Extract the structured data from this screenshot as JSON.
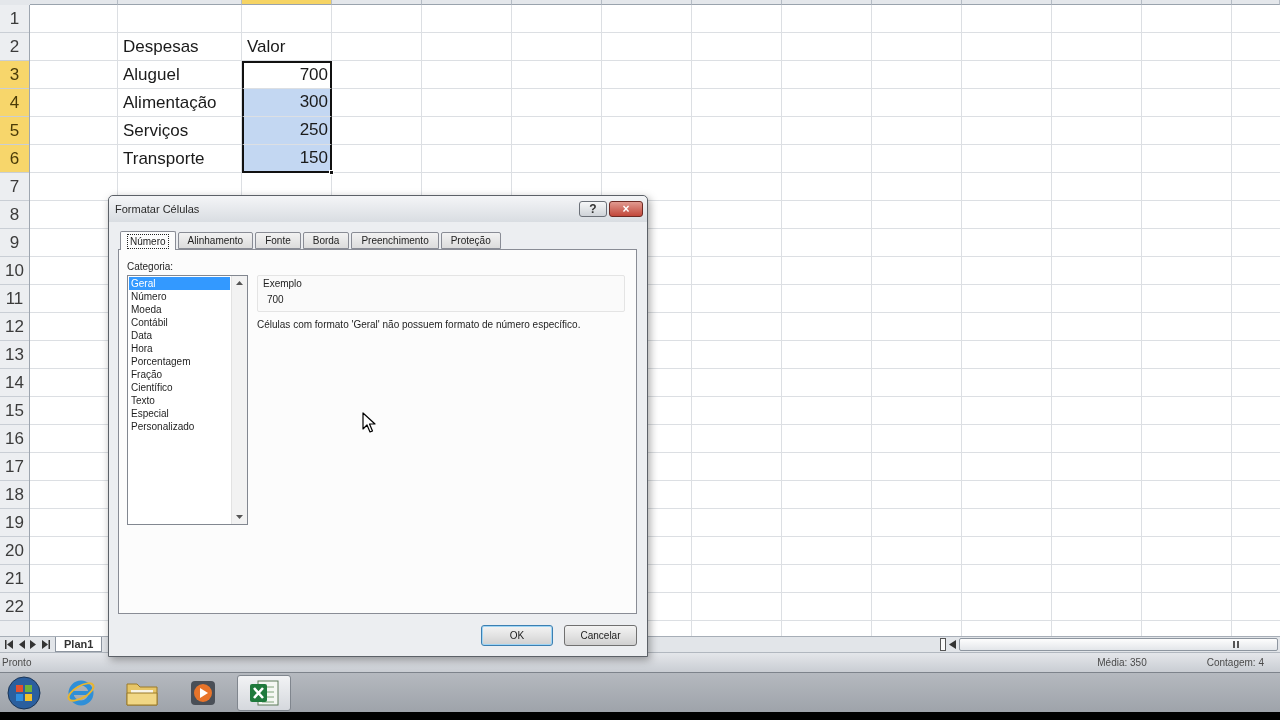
{
  "column_headers": [
    {
      "selected": false
    },
    {
      "selected": false
    },
    {
      "selected": true
    },
    {
      "selected": false
    },
    {
      "selected": false
    },
    {
      "selected": false
    },
    {
      "selected": false
    },
    {
      "selected": false
    },
    {
      "selected": false
    },
    {
      "selected": false
    },
    {
      "selected": false
    },
    {
      "selected": false
    },
    {
      "selected": false
    },
    {
      "selected": false
    }
  ],
  "row_headers": [
    {
      "label": "1",
      "selected": false
    },
    {
      "label": "2",
      "selected": false
    },
    {
      "label": "3",
      "selected": true
    },
    {
      "label": "4",
      "selected": true
    },
    {
      "label": "5",
      "selected": true
    },
    {
      "label": "6",
      "selected": true
    },
    {
      "label": "7",
      "selected": false
    },
    {
      "label": "8",
      "selected": false
    },
    {
      "label": "9",
      "selected": false
    },
    {
      "label": "10",
      "selected": false
    },
    {
      "label": "11",
      "selected": false
    },
    {
      "label": "12",
      "selected": false
    },
    {
      "label": "13",
      "selected": false
    },
    {
      "label": "14",
      "selected": false
    },
    {
      "label": "15",
      "selected": false
    },
    {
      "label": "16",
      "selected": false
    },
    {
      "label": "17",
      "selected": false
    },
    {
      "label": "18",
      "selected": false
    },
    {
      "label": "19",
      "selected": false
    },
    {
      "label": "20",
      "selected": false
    },
    {
      "label": "21",
      "selected": false
    },
    {
      "label": "22",
      "selected": false
    }
  ],
  "table": {
    "columns": [
      "Despesas",
      "Valor"
    ],
    "rows": [
      {
        "label": "Aluguel",
        "value": "700",
        "selected": true,
        "active": true
      },
      {
        "label": "Alimentação",
        "value": "300",
        "selected": true,
        "active": false
      },
      {
        "label": "Serviços",
        "value": "250",
        "selected": true,
        "active": false
      },
      {
        "label": "Transporte",
        "value": "150",
        "selected": true,
        "active": false
      }
    ]
  },
  "dialog": {
    "title": "Formatar Células",
    "title_buttons": [
      {
        "kind": "help",
        "text": "?"
      },
      {
        "kind": "close",
        "text": "×"
      }
    ],
    "tabs": [
      {
        "label": "Número",
        "selected": true
      },
      {
        "label": "Alinhamento",
        "selected": false
      },
      {
        "label": "Fonte",
        "selected": false
      },
      {
        "label": "Borda",
        "selected": false
      },
      {
        "label": "Preenchimento",
        "selected": false
      },
      {
        "label": "Proteção",
        "selected": false
      }
    ],
    "category_label": "Categoria:",
    "categories": [
      {
        "label": "Geral",
        "selected": true
      },
      {
        "label": "Número",
        "selected": false
      },
      {
        "label": "Moeda",
        "selected": false
      },
      {
        "label": "Contábil",
        "selected": false
      },
      {
        "label": "Data",
        "selected": false
      },
      {
        "label": "Hora",
        "selected": false
      },
      {
        "label": "Porcentagem",
        "selected": false
      },
      {
        "label": "Fração",
        "selected": false
      },
      {
        "label": "Científico",
        "selected": false
      },
      {
        "label": "Texto",
        "selected": false
      },
      {
        "label": "Especial",
        "selected": false
      },
      {
        "label": "Personalizado",
        "selected": false
      }
    ],
    "sample_label": "Exemplo",
    "sample_value": "700",
    "description": "Células com formato 'Geral' não possuem formato de número específico.",
    "buttons": [
      {
        "label": "OK",
        "default": true
      },
      {
        "label": "Cancelar",
        "default": false
      }
    ]
  },
  "sheet_tabs": [
    {
      "label": "Plan1",
      "selected": true
    }
  ],
  "status_bar": {
    "mode": "Pronto",
    "average": "Média: 350",
    "count": "Contagem: 4"
  },
  "taskbar": [
    {
      "kind": "browser",
      "active": false
    },
    {
      "kind": "folder",
      "active": false
    },
    {
      "kind": "media",
      "active": false
    },
    {
      "kind": "spreadsheet",
      "active": true
    }
  ]
}
